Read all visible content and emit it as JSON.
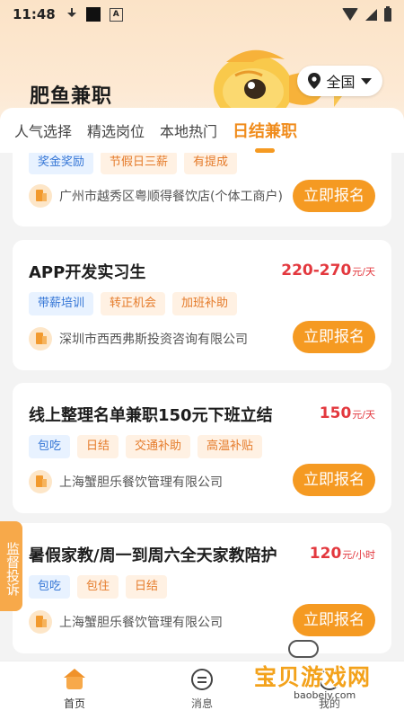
{
  "statusbar": {
    "time": "11:48"
  },
  "header": {
    "app_title": "肥鱼兼职",
    "city": "全国"
  },
  "tabs": [
    {
      "label": "人气选择",
      "active": false
    },
    {
      "label": "精选岗位",
      "active": false
    },
    {
      "label": "本地热门",
      "active": false
    },
    {
      "label": "日结兼职",
      "active": true
    }
  ],
  "cards": [
    {
      "title": "",
      "salary": "",
      "unit": "",
      "tags": [
        {
          "label": "奖金奖励",
          "color": "blue"
        },
        {
          "label": "节假日三薪",
          "color": "orange"
        },
        {
          "label": "有提成",
          "color": "orange"
        }
      ],
      "company": "广州市越秀区粤顺得餐饮店(个体工商户)",
      "apply": "立即报名"
    },
    {
      "title": "APP开发实习生",
      "salary": "220-270",
      "unit": "元/天",
      "tags": [
        {
          "label": "带薪培训",
          "color": "blue"
        },
        {
          "label": "转正机会",
          "color": "orange"
        },
        {
          "label": "加班补助",
          "color": "orange"
        }
      ],
      "company": "深圳市西西弗斯投资咨询有限公司",
      "apply": "立即报名"
    },
    {
      "title": "线上整理名单兼职150元下班立结",
      "salary": "150",
      "unit": "元/天",
      "tags": [
        {
          "label": "包吃",
          "color": "blue"
        },
        {
          "label": "日结",
          "color": "orange"
        },
        {
          "label": "交通补助",
          "color": "orange"
        },
        {
          "label": "高温补贴",
          "color": "orange"
        }
      ],
      "company": "上海蟹胆乐餐饮管理有限公司",
      "apply": "立即报名"
    },
    {
      "title": "暑假家教/周一到周六全天家教陪护",
      "salary": "120",
      "unit": "元/小时",
      "tags": [
        {
          "label": "包吃",
          "color": "blue"
        },
        {
          "label": "包住",
          "color": "orange"
        },
        {
          "label": "日结",
          "color": "orange"
        }
      ],
      "company": "上海蟹胆乐餐饮管理有限公司",
      "apply": "立即报名"
    }
  ],
  "complaint": "监督投诉",
  "bottomnav": {
    "home": "首页",
    "messages": "消息",
    "me": "我的"
  },
  "watermark": {
    "text": "宝贝游戏网",
    "url": "baobeiy.com"
  }
}
